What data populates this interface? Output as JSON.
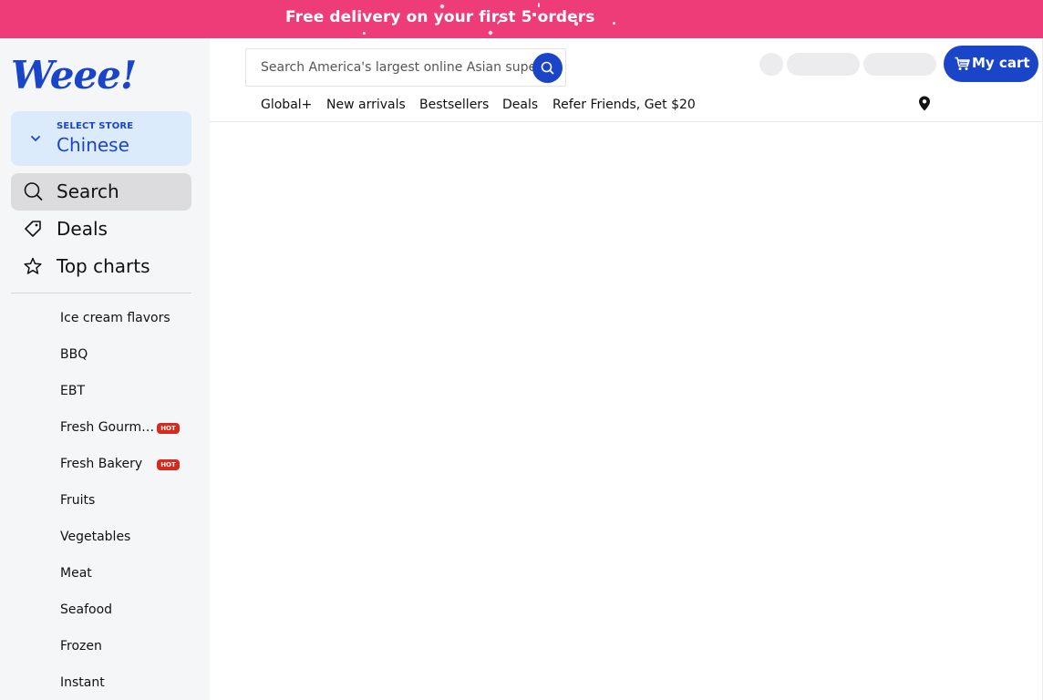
{
  "promo": {
    "text": "Free delivery on your first 5 orders"
  },
  "brand": {
    "logo_text": "Weee!",
    "accent": "#1a45c8",
    "promo_color": "#ee3c78"
  },
  "store": {
    "small_label": "SELECT STORE",
    "name": "Chinese"
  },
  "nav": [
    {
      "label": "Search",
      "icon": "search-icon"
    },
    {
      "label": "Deals",
      "icon": "tag-icon"
    },
    {
      "label": "Top charts",
      "icon": "star-icon"
    }
  ],
  "categories": [
    {
      "label": "Ice cream flavors"
    },
    {
      "label": "BBQ"
    },
    {
      "label": "EBT"
    },
    {
      "label": "Fresh Gourm…",
      "badge": "HOT"
    },
    {
      "label": "Fresh Bakery",
      "badge": "HOT"
    },
    {
      "label": "Fruits"
    },
    {
      "label": "Vegetables"
    },
    {
      "label": "Meat"
    },
    {
      "label": "Seafood"
    },
    {
      "label": "Frozen"
    },
    {
      "label": "Instant"
    }
  ],
  "search": {
    "placeholder": "Search America's largest online Asian supermarket"
  },
  "cart": {
    "label": "My cart",
    "icon": "cart-icon"
  },
  "topnav": [
    {
      "label": "Global+"
    },
    {
      "label": "New arrivals"
    },
    {
      "label": "Bestsellers"
    },
    {
      "label": "Deals"
    },
    {
      "label": "Refer Friends, Get $20"
    }
  ],
  "location_icon": "location-pin-icon"
}
